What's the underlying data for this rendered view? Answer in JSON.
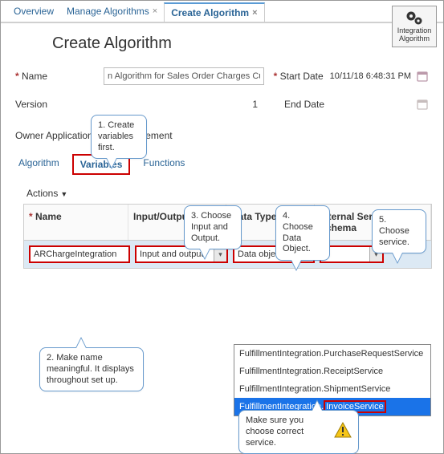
{
  "top_tabs": {
    "overview": "Overview",
    "manage": "Manage Algorithms",
    "create": "Create Algorithm"
  },
  "integration_button": {
    "line1": "Integration",
    "line2": "Algorithm"
  },
  "page_title": "Create Algorithm",
  "form": {
    "name_label": "Name",
    "name_value": "n Algorithm for Sales Order Charges Custom",
    "version_label": "Version",
    "version_value": "1",
    "owner_label": "Owner Application",
    "owner_value": "Oᵣ       Management",
    "start_label": "Start Date",
    "start_value": "10/11/18 6:48:31 PM",
    "end_label": "End Date",
    "end_value": ""
  },
  "subtabs": {
    "alg": "Algorithm",
    "vars": "Variables",
    "fn": "Functions"
  },
  "grid": {
    "actions": "Actions",
    "head_name": "Name",
    "head_io": "Input/Output",
    "head_dt": "Data Type",
    "head_svc": "Internal Service Schema",
    "row_name": "ARChargeIntegration",
    "row_io": "Input and output",
    "row_dt": "Data object",
    "row_svc": ""
  },
  "dropdown": {
    "opt1_pfx": "FulfillmentIntegration.",
    "opt1_svc": "PurchaseRequestService",
    "opt2_pfx": "FulfillmentIntegration.",
    "opt2_svc": "ReceiptService",
    "opt3_pfx": "FulfillmentIntegration.",
    "opt3_svc": "ShipmentService",
    "opt4_pfx": "FulfillmentIntegration.",
    "opt4_svc": "InvoiceService"
  },
  "callouts": {
    "c1": "1. Create variables first.",
    "c2": "2. Make name meaningful.  It displays throughout  set up.",
    "c3": "3. Choose Input and Output.",
    "c4": "4. Choose Data Object.",
    "c5": "5. Choose service.",
    "c6": "Make sure you choose correct service."
  }
}
